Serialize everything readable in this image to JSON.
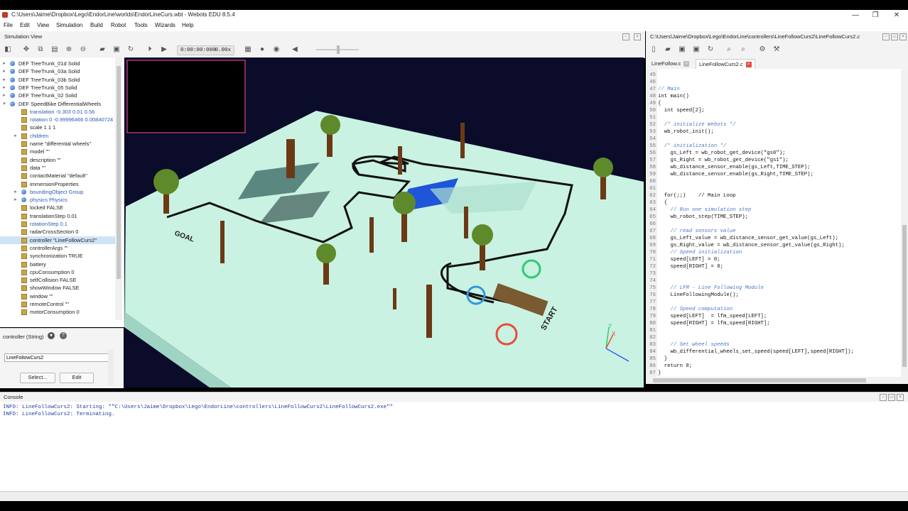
{
  "window": {
    "title": "C:\\Users\\Jaime\\Dropbox\\Lego\\EndorLine\\worlds\\EndorLineCurs.wbt - Webots EDU 8.5.4",
    "controls": [
      "—",
      "❐",
      "✕"
    ]
  },
  "menu": [
    "File",
    "Edit",
    "View",
    "Simulation",
    "Build",
    "Robot",
    "Tools",
    "Wizards",
    "Help"
  ],
  "simulation_view": {
    "title": "Simulation View",
    "time": "0:00:00:000",
    "speed": "0.00x"
  },
  "scene_tree": [
    {
      "label": "DEF TreeTrunk_01d Solid",
      "type": "node",
      "arrow": "▸",
      "indent": 0
    },
    {
      "label": "DEF TreeTrunk_03a Solid",
      "type": "node",
      "arrow": "▸",
      "indent": 0
    },
    {
      "label": "DEF TreeTrunk_03b Solid",
      "type": "node",
      "arrow": "▸",
      "indent": 0
    },
    {
      "label": "DEF TreeTrunk_05 Solid",
      "type": "node",
      "arrow": "▸",
      "indent": 0
    },
    {
      "label": "DEF TreeTrunk_02 Solid",
      "type": "node",
      "arrow": "▸",
      "indent": 0
    },
    {
      "label": "DEF SpeedBike DifferentialWheels",
      "type": "node",
      "arrow": "▾",
      "indent": 0
    },
    {
      "label": "translation -0.303 0.01 0.56",
      "type": "field",
      "arrow": "",
      "indent": 1,
      "blue": true
    },
    {
      "label": "rotation 0 -0.99996466 0.00840724",
      "type": "field",
      "arrow": "",
      "indent": 1,
      "blue": true
    },
    {
      "label": "scale 1 1 1",
      "type": "field",
      "arrow": "",
      "indent": 1
    },
    {
      "label": "children",
      "type": "field",
      "arrow": "▸",
      "indent": 1,
      "blue": true
    },
    {
      "label": "name \"differential wheels\"",
      "type": "field",
      "arrow": "",
      "indent": 1
    },
    {
      "label": "model \"\"",
      "type": "field",
      "arrow": "",
      "indent": 1
    },
    {
      "label": "description \"\"",
      "type": "field",
      "arrow": "",
      "indent": 1
    },
    {
      "label": "data \"\"",
      "type": "field",
      "arrow": "",
      "indent": 1
    },
    {
      "label": "contactMaterial \"default\"",
      "type": "field",
      "arrow": "",
      "indent": 1
    },
    {
      "label": "immersionProperties",
      "type": "field",
      "arrow": "",
      "indent": 1
    },
    {
      "label": "boundingObject Group",
      "type": "node",
      "arrow": "▸",
      "indent": 1,
      "blue": true
    },
    {
      "label": "physics Physics",
      "type": "node",
      "arrow": "▸",
      "indent": 1,
      "blue": true
    },
    {
      "label": "locked FALSE",
      "type": "field",
      "arrow": "",
      "indent": 1
    },
    {
      "label": "translationStep 0.01",
      "type": "field",
      "arrow": "",
      "indent": 1
    },
    {
      "label": "rotationStep 0.1",
      "type": "field",
      "arrow": "",
      "indent": 1,
      "blue": true
    },
    {
      "label": "radarCrossSection 0",
      "type": "field",
      "arrow": "",
      "indent": 1
    },
    {
      "label": "controller \"LineFollowCurs2\"",
      "type": "field",
      "arrow": "",
      "indent": 1,
      "selected": true
    },
    {
      "label": "controllerArgs \"\"",
      "type": "field",
      "arrow": "",
      "indent": 1
    },
    {
      "label": "synchronization TRUE",
      "type": "field",
      "arrow": "",
      "indent": 1
    },
    {
      "label": "battery",
      "type": "field",
      "arrow": "",
      "indent": 1
    },
    {
      "label": "cpuConsumption 0",
      "type": "field",
      "arrow": "",
      "indent": 1
    },
    {
      "label": "selfCollision FALSE",
      "type": "field",
      "arrow": "",
      "indent": 1
    },
    {
      "label": "showWindow FALSE",
      "type": "field",
      "arrow": "",
      "indent": 1
    },
    {
      "label": "window \"\"",
      "type": "field",
      "arrow": "",
      "indent": 1
    },
    {
      "label": "remoteControl \"\"",
      "type": "field",
      "arrow": "",
      "indent": 1
    },
    {
      "label": "motorConsumption 0",
      "type": "field",
      "arrow": "",
      "indent": 1
    }
  ],
  "field_editor": {
    "label": "controller (String)",
    "value": "LineFollowCurs2",
    "select_label": "Select...",
    "edit_label": "Edit"
  },
  "viewport": {
    "goal_label": "GOAL",
    "start_label": "START",
    "axis_x": "X",
    "axis_y": "Y"
  },
  "editor": {
    "title": "C:\\Users\\Jaime\\Dropbox\\Lego\\EndorLine\\controllers\\LineFollowCurs2\\LineFollowCurs2.c",
    "tabs": [
      {
        "label": "LineFollow.c",
        "active": false
      },
      {
        "label": "LineFollowCurs2.c",
        "active": true
      }
    ],
    "lines": [
      {
        "n": "45",
        "text": "",
        "kind": "kw"
      },
      {
        "n": "46",
        "text": "",
        "kind": "kw"
      },
      {
        "n": "47",
        "text": "// Main",
        "kind": "comment"
      },
      {
        "n": "48",
        "text": "int main()",
        "kind": "kw"
      },
      {
        "n": "49",
        "text": "{",
        "kind": "kw"
      },
      {
        "n": "50",
        "text": "  int speed[2];",
        "kind": "kw"
      },
      {
        "n": "51",
        "text": "",
        "kind": "kw"
      },
      {
        "n": "52",
        "text": "  /* initialize Webots */",
        "kind": "comment"
      },
      {
        "n": "53",
        "text": "  wb_robot_init();",
        "kind": "kw"
      },
      {
        "n": "54",
        "text": "",
        "kind": "kw"
      },
      {
        "n": "55",
        "text": "  /* initialization */",
        "kind": "comment"
      },
      {
        "n": "56",
        "text": "    gs_Left = wb_robot_get_device(\"gs0\");",
        "kind": "kw"
      },
      {
        "n": "57",
        "text": "    gs_Right = wb_robot_get_device(\"gs1\");",
        "kind": "kw"
      },
      {
        "n": "58",
        "text": "    wb_distance_sensor_enable(gs_Left,TIME_STEP);",
        "kind": "kw"
      },
      {
        "n": "59",
        "text": "    wb_distance_sensor_enable(gs_Right,TIME_STEP);",
        "kind": "kw"
      },
      {
        "n": "60",
        "text": "",
        "kind": "kw"
      },
      {
        "n": "61",
        "text": "",
        "kind": "kw"
      },
      {
        "n": "62",
        "text": "  for(;;)    // Main Loop",
        "kind": "kw"
      },
      {
        "n": "63",
        "text": "  {",
        "kind": "kw"
      },
      {
        "n": "64",
        "text": "    // Run one simulation step",
        "kind": "comment"
      },
      {
        "n": "65",
        "text": "    wb_robot_step(TIME_STEP);",
        "kind": "kw"
      },
      {
        "n": "66",
        "text": "",
        "kind": "kw"
      },
      {
        "n": "67",
        "text": "    // read sensors value",
        "kind": "comment"
      },
      {
        "n": "68",
        "text": "    gs_Left_value = wb_distance_sensor_get_value(gs_Left);",
        "kind": "kw"
      },
      {
        "n": "69",
        "text": "    gs_Right_value = wb_distance_sensor_get_value(gs_Right);",
        "kind": "kw"
      },
      {
        "n": "70",
        "text": "    // Speed initialization",
        "kind": "comment"
      },
      {
        "n": "71",
        "text": "    speed[LEFT] = 0;",
        "kind": "kw"
      },
      {
        "n": "72",
        "text": "    speed[RIGHT] = 0;",
        "kind": "kw"
      },
      {
        "n": "73",
        "text": "",
        "kind": "kw"
      },
      {
        "n": "74",
        "text": "",
        "kind": "kw"
      },
      {
        "n": "75",
        "text": "    // LFM - Line Following Module",
        "kind": "comment"
      },
      {
        "n": "76",
        "text": "    LineFollowingModule();",
        "kind": "kw"
      },
      {
        "n": "77",
        "text": "",
        "kind": "kw"
      },
      {
        "n": "78",
        "text": "    // Speed computation",
        "kind": "comment"
      },
      {
        "n": "79",
        "text": "    speed[LEFT]  = lfm_speed[LEFT];",
        "kind": "kw"
      },
      {
        "n": "80",
        "text": "    speed[RIGHT] = lfm_speed[RIGHT];",
        "kind": "kw"
      },
      {
        "n": "81",
        "text": "",
        "kind": "kw"
      },
      {
        "n": "82",
        "text": "",
        "kind": "kw"
      },
      {
        "n": "83",
        "text": "    // Set wheel speeds",
        "kind": "comment"
      },
      {
        "n": "84",
        "text": "    wb_differential_wheels_set_speed(speed[LEFT],speed[RIGHT]);",
        "kind": "kw"
      },
      {
        "n": "85",
        "text": "  }",
        "kind": "kw"
      },
      {
        "n": "86",
        "text": "  return 0;",
        "kind": "kw"
      },
      {
        "n": "87",
        "text": "}",
        "kind": "kw"
      }
    ]
  },
  "console": {
    "title": "Console",
    "lines": [
      "INFO: LineFollowCurs2: Starting: \"\"C:\\Users\\Jaime\\Dropbox\\Lego\\EndorLine\\controllers\\LineFollowCurs2\\LineFollowCurs2.exe\"\"",
      "INFO: LineFollowCurs2: Terminating."
    ]
  },
  "colors": {
    "floor": "#c9f2e2",
    "track": "#111111",
    "pond": "#1f55d8",
    "sky": "#0b0b2a",
    "tree_trunk": "#6b3a15",
    "foliage": "#5e8a2b",
    "accent_red": "#e74c3c"
  }
}
